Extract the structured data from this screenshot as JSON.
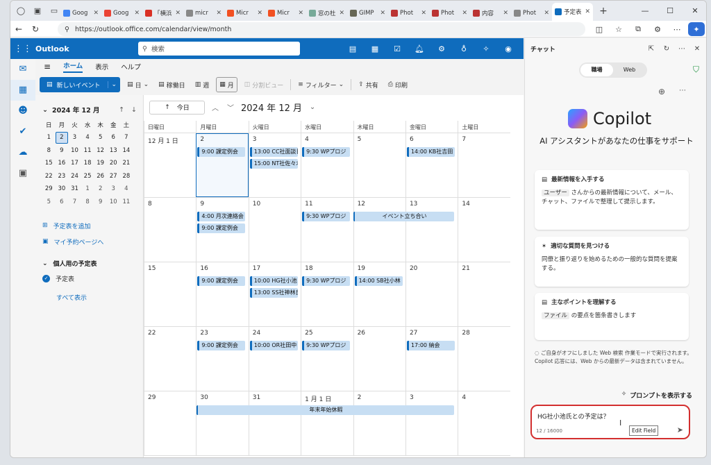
{
  "browser": {
    "tabs": [
      {
        "label": "Goog",
        "fav": "#4285f4"
      },
      {
        "label": "Goog",
        "fav": "#ea4335"
      },
      {
        "label": "「横浜",
        "fav": "#d93025"
      },
      {
        "label": "micr",
        "fav": "#888"
      },
      {
        "label": "Micr",
        "fav": "#f25022"
      },
      {
        "label": "Micr",
        "fav": "#f25022"
      },
      {
        "label": "窓の杜",
        "fav": "#7a9"
      },
      {
        "label": "GIMP",
        "fav": "#665"
      },
      {
        "label": "Phot",
        "fav": "#b33"
      },
      {
        "label": "Phot",
        "fav": "#b33"
      },
      {
        "label": "内容",
        "fav": "#b33"
      },
      {
        "label": "Phot",
        "fav": "#888"
      },
      {
        "label": "予定表",
        "fav": "#0f6cbd"
      }
    ],
    "url": "https://outlook.office.com/calendar/view/month"
  },
  "outlook": {
    "app_name": "Outlook",
    "search_placeholder": "検索",
    "ribbon_tabs": [
      "ホーム",
      "表示",
      "ヘルプ"
    ],
    "toolbar": {
      "new_event": "新しいイベント",
      "day": "日",
      "workweek": "稼働日",
      "week": "週",
      "month": "月",
      "split": "分割ビュー",
      "filter": "フィルター",
      "share": "共有",
      "print": "印刷"
    },
    "minical": {
      "title": "2024 年 12 月",
      "dow": [
        "日",
        "月",
        "火",
        "水",
        "木",
        "金",
        "土"
      ],
      "days": [
        "1",
        "2",
        "3",
        "4",
        "5",
        "6",
        "7",
        "8",
        "9",
        "10",
        "11",
        "12",
        "13",
        "14",
        "15",
        "16",
        "17",
        "18",
        "19",
        "20",
        "21",
        "22",
        "23",
        "24",
        "25",
        "26",
        "27",
        "28",
        "29",
        "30",
        "31",
        "1",
        "2",
        "3",
        "4",
        "5",
        "6",
        "7",
        "8",
        "9",
        "10",
        "11"
      ],
      "today_index": 1
    },
    "side": {
      "add_calendar": "予定表を追加",
      "booking": "マイ予約ページへ",
      "my_cals": "個人用の予定表",
      "cal_name": "予定表",
      "show_all": "すべて表示"
    },
    "calnav": {
      "today": "今日",
      "title": "2024 年 12 月"
    },
    "dow": [
      "日曜日",
      "月曜日",
      "火曜日",
      "水曜日",
      "木曜日",
      "金曜日",
      "土曜日"
    ],
    "weeks": [
      [
        "12 月 1 日",
        "2",
        "3",
        "4",
        "5",
        "6",
        "7"
      ],
      [
        "8",
        "9",
        "10",
        "11",
        "12",
        "13",
        "14"
      ],
      [
        "15",
        "16",
        "17",
        "18",
        "19",
        "20",
        "21"
      ],
      [
        "22",
        "23",
        "24",
        "25",
        "26",
        "27",
        "28"
      ],
      [
        "29",
        "30",
        "31",
        "1 月 1 日",
        "2",
        "3",
        "4"
      ]
    ],
    "events": {
      "w0": [
        "9:00 課定例会",
        "13:00 CC社面談日",
        "15:00 NT社佐々木",
        "9:30 WPプロジ",
        "14:00 KB社吉田"
      ],
      "w1": [
        "4:00 月次連絡会",
        "9:00 課定例会",
        "9:30 WPプロジ",
        "イベント立ち合い"
      ],
      "w2": [
        "9:00 課定例会",
        "10:00 HG社小池",
        "13:00 SS社神林氏",
        "9:30 WPプロジ",
        "14:00 SB社小林"
      ],
      "w3": [
        "9:00 課定例会",
        "10:00 OR社田中",
        "9:30 WPプロジ",
        "17:00 納会"
      ],
      "w4": [
        "年末年始休暇"
      ]
    }
  },
  "copilot": {
    "pane_title": "チャット",
    "toggle": [
      "職場",
      "Web"
    ],
    "logo": "Copilot",
    "tagline": "AI アシスタントがあなたの仕事をサポート",
    "cards": [
      {
        "title": "最新情報を入手する",
        "chip": "ユーザー",
        "body": " さんからの最新情報について、メール、チャット、ファイルで整理して提示します。"
      },
      {
        "title": "適切な質問を見つける",
        "chip": "",
        "body": "同僚と振り返りを始めるための一般的な質問を提案する。"
      },
      {
        "title": "主なポイントを理解する",
        "chip": "ファイル",
        "body": " の要点を箇条書きします"
      }
    ],
    "note": "ご自身がオフにしました Web 検索 作業モードで実行されます。Copilot 応答には、Web からの最新データは含まれていません。",
    "show_prompts": "プロンプトを表示する",
    "input_text": "HG社小池氏との予定は？",
    "counter": "12 / 16000",
    "tooltip": "Edit Field"
  }
}
